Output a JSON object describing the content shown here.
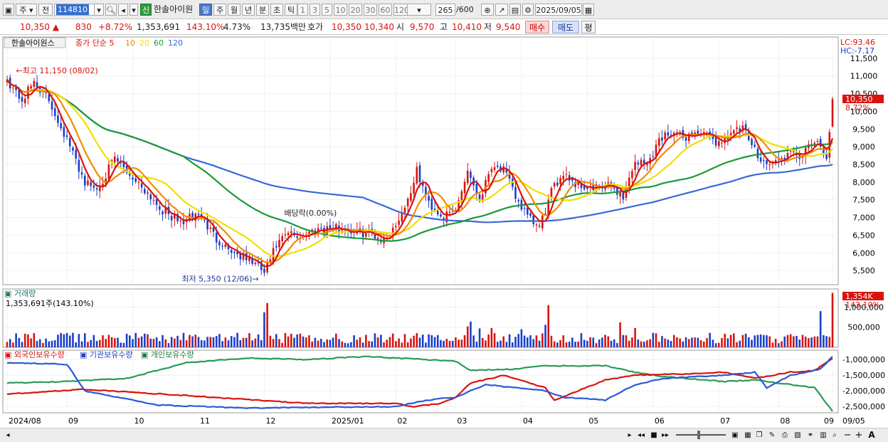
{
  "toolbar": {
    "market": "주",
    "mode": "전",
    "code": "114810",
    "new_badge": "신",
    "stock_name": "한솔아이원",
    "periods": [
      "일",
      "주",
      "월",
      "년",
      "분",
      "초",
      "틱"
    ],
    "active_period": "일",
    "intervals": [
      "1",
      "3",
      "5",
      "10",
      "20",
      "30",
      "60",
      "120"
    ],
    "count": "265",
    "count_total": "/600",
    "date": "2025/09/05"
  },
  "quote": {
    "price": "10,350",
    "change": "830",
    "change_pct": "+8.72%",
    "volume": "1,353,691",
    "vol_ratio": "143.10%",
    "turnover": "4.73%",
    "amount": "13,735백만",
    "bid_label": "호가",
    "ask": "10,350",
    "bid": "10,340",
    "open_label": "시",
    "open": "9,570",
    "high_label": "고",
    "high": "10,410",
    "low_label": "저",
    "low": "9,540",
    "buy_label": "매수",
    "sell_label": "매도",
    "eval_label": "평"
  },
  "colors": {
    "up": "#d8140e",
    "down": "#1a3fc8",
    "ma5": "#d8140e",
    "ma10": "#f08c00",
    "ma20": "#f0e000",
    "ma60": "#1a9a3a",
    "ma120": "#3a68d8"
  },
  "scroll": {
    "zoom_minus": "−",
    "zoom_plus": "+",
    "font_label": "A"
  },
  "chart_data": {
    "type": "candlestick",
    "title": "한솔아이원스",
    "ma_label": "종가 단순",
    "ma_periods": [
      "5",
      "10",
      "20",
      "60",
      "120"
    ],
    "lc_label": "LC:93.46",
    "hc_label": "HC:-7.17",
    "price_ticks": [
      "5,500",
      "6,000",
      "6,500",
      "7,000",
      "7,500",
      "8,000",
      "8,500",
      "9,000",
      "9,500",
      "10,000",
      "10,500",
      "11,000",
      "11,500"
    ],
    "price_tick_values": [
      5500,
      6000,
      6500,
      7000,
      7500,
      8000,
      8500,
      9000,
      9500,
      10000,
      10500,
      11000,
      11500
    ],
    "ylim": [
      5100,
      12100
    ],
    "current_price_label": "10,350",
    "current_pct_label": "8.72%",
    "high_annotation": "최고 11,150 (08/02)",
    "low_annotation": "최저 5,350 (12/06)",
    "dividend_annotation": "배당락(0.00%)",
    "x_labels": [
      "2024/08",
      "09",
      "10",
      "11",
      "12",
      "2025/01",
      "02",
      "03",
      "04",
      "05",
      "06",
      "07",
      "08",
      "09",
      "09/05"
    ],
    "price_anchors": [
      [
        0,
        10900
      ],
      [
        5,
        10300
      ],
      [
        9,
        10850
      ],
      [
        14,
        10300
      ],
      [
        20,
        9200
      ],
      [
        26,
        8000
      ],
      [
        30,
        7800
      ],
      [
        36,
        8650
      ],
      [
        40,
        8300
      ],
      [
        46,
        7800
      ],
      [
        52,
        7200
      ],
      [
        58,
        6850
      ],
      [
        64,
        7100
      ],
      [
        70,
        6400
      ],
      [
        76,
        6000
      ],
      [
        82,
        5750
      ],
      [
        86,
        5450
      ],
      [
        90,
        6200
      ],
      [
        94,
        6550
      ],
      [
        98,
        6450
      ],
      [
        104,
        6700
      ],
      [
        110,
        6700
      ],
      [
        116,
        6600
      ],
      [
        122,
        6550
      ],
      [
        126,
        6350
      ],
      [
        130,
        6800
      ],
      [
        134,
        7500
      ],
      [
        137,
        8300
      ],
      [
        141,
        7400
      ],
      [
        146,
        7000
      ],
      [
        150,
        7200
      ],
      [
        154,
        8350
      ],
      [
        158,
        7500
      ],
      [
        162,
        8500
      ],
      [
        166,
        8350
      ],
      [
        170,
        7600
      ],
      [
        174,
        7000
      ],
      [
        178,
        6700
      ],
      [
        182,
        7700
      ],
      [
        186,
        8300
      ],
      [
        190,
        7950
      ],
      [
        196,
        7800
      ],
      [
        202,
        7900
      ],
      [
        206,
        7600
      ],
      [
        210,
        8600
      ],
      [
        214,
        8500
      ],
      [
        218,
        9200
      ],
      [
        222,
        9450
      ],
      [
        226,
        9250
      ],
      [
        230,
        9400
      ],
      [
        234,
        9300
      ],
      [
        238,
        9100
      ],
      [
        242,
        9400
      ],
      [
        246,
        9500
      ],
      [
        250,
        8900
      ],
      [
        254,
        8500
      ],
      [
        258,
        8600
      ],
      [
        262,
        8800
      ],
      [
        266,
        8750
      ],
      [
        270,
        9150
      ],
      [
        274,
        8700
      ],
      [
        276,
        10350
      ]
    ],
    "volume_label": "거래량",
    "volume_value_label": "1,353,691주(143.10%)",
    "volume_ticks": [
      "500,000",
      "1,000,000"
    ],
    "volume_tick_values": [
      500000,
      1000000
    ],
    "volume_current_label": "1,354K",
    "volume_current_pct": "143.10%",
    "volume_spikes": [
      [
        86,
        870000
      ],
      [
        87,
        1100000
      ],
      [
        154,
        520000
      ],
      [
        155,
        640000
      ],
      [
        158,
        470000
      ],
      [
        162,
        480000
      ],
      [
        172,
        450000
      ],
      [
        180,
        560000
      ],
      [
        181,
        1050000
      ],
      [
        205,
        620000
      ],
      [
        210,
        480000
      ],
      [
        272,
        900000
      ],
      [
        276,
        1353691
      ]
    ],
    "holdings_title_1": "외국인보유수량",
    "holdings_title_2": "기관보유수량",
    "holdings_title_3": "개인보유수량",
    "holdings_ticks": [
      "-1,000,000",
      "-1,500,000",
      "-2,000,000",
      "-2,500,000"
    ],
    "holdings_tick_values": [
      -1000000,
      -1500000,
      -2000000,
      -2500000
    ],
    "holdings_ylim": [
      -2700000,
      -700000
    ],
    "foreign_anchors": [
      [
        0,
        -1100000
      ],
      [
        20,
        -1150000
      ],
      [
        26,
        -2000000
      ],
      [
        50,
        -2450000
      ],
      [
        80,
        -2550000
      ],
      [
        130,
        -2500000
      ],
      [
        140,
        -2300000
      ],
      [
        150,
        -2200000
      ],
      [
        160,
        -1800000
      ],
      [
        170,
        -1900000
      ],
      [
        180,
        -2000000
      ],
      [
        186,
        -2200000
      ],
      [
        200,
        -2300000
      ],
      [
        210,
        -1800000
      ],
      [
        220,
        -1600000
      ],
      [
        240,
        -1500000
      ],
      [
        250,
        -1400000
      ],
      [
        254,
        -1900000
      ],
      [
        262,
        -1500000
      ],
      [
        272,
        -1300000
      ],
      [
        276,
        -900000
      ]
    ],
    "inst_anchors": [
      [
        0,
        -1750000
      ],
      [
        20,
        -1700000
      ],
      [
        40,
        -1600000
      ],
      [
        60,
        -1100000
      ],
      [
        80,
        -950000
      ],
      [
        100,
        -1000000
      ],
      [
        120,
        -900000
      ],
      [
        150,
        -1050000
      ],
      [
        155,
        -1350000
      ],
      [
        170,
        -1300000
      ],
      [
        180,
        -1200000
      ],
      [
        200,
        -1200000
      ],
      [
        210,
        -1400000
      ],
      [
        220,
        -1550000
      ],
      [
        240,
        -1700000
      ],
      [
        250,
        -1650000
      ],
      [
        262,
        -1800000
      ],
      [
        270,
        -1900000
      ],
      [
        276,
        -2650000
      ]
    ],
    "indiv_anchors": [
      [
        0,
        -2100000
      ],
      [
        26,
        -1950000
      ],
      [
        60,
        -2150000
      ],
      [
        84,
        -2300000
      ],
      [
        100,
        -2400000
      ],
      [
        130,
        -2400000
      ],
      [
        136,
        -2500000
      ],
      [
        145,
        -2400000
      ],
      [
        150,
        -2200000
      ],
      [
        155,
        -1750000
      ],
      [
        166,
        -1500000
      ],
      [
        180,
        -1900000
      ],
      [
        183,
        -2300000
      ],
      [
        200,
        -1650000
      ],
      [
        210,
        -1500000
      ],
      [
        230,
        -1450000
      ],
      [
        240,
        -1400000
      ],
      [
        250,
        -1600000
      ],
      [
        262,
        -1400000
      ],
      [
        270,
        -1350000
      ],
      [
        276,
        -950000
      ]
    ]
  }
}
